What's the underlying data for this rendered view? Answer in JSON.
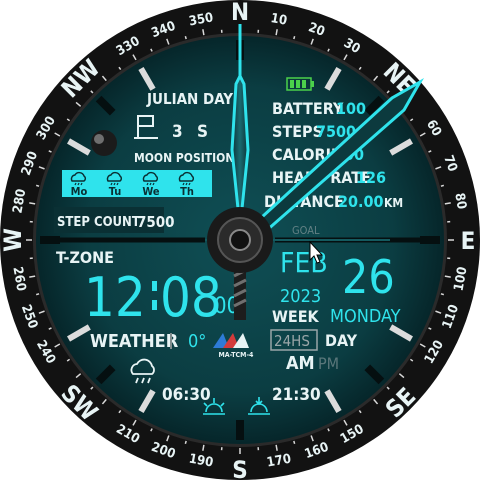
{
  "compass": {
    "cardinals": {
      "n": "N",
      "ne": "NE",
      "e": "E",
      "se": "SE",
      "s": "S",
      "sw": "SW",
      "w": "W",
      "nw": "NW"
    },
    "degrees": [
      "10",
      "20",
      "30",
      "60",
      "70",
      "80",
      "100",
      "110",
      "120",
      "150",
      "160",
      "170",
      "190",
      "200",
      "210",
      "240",
      "250",
      "260",
      "280",
      "290",
      "300",
      "330",
      "340",
      "350"
    ]
  },
  "julian": {
    "label": "JULIAN DAY",
    "value": "3",
    "unit": "S"
  },
  "moon": {
    "label": "MOON POSITION"
  },
  "forecast": {
    "days": [
      "Mo",
      "Tu",
      "We",
      "Th"
    ]
  },
  "steps": {
    "label": "STEP COUNT",
    "value": "7500",
    "goal_label": "GOAL"
  },
  "stats": {
    "battery_label": "BATTERY",
    "battery_value": "100",
    "steps_label": "STEPS",
    "steps_value": "7500",
    "calorie_label": "CALORIE",
    "calorie_value": "500",
    "heart_label": "HEART RATE",
    "heart_value": "126",
    "distance_label": "DISTANCE",
    "distance_value": "20.00",
    "distance_unit": "KM"
  },
  "time": {
    "zone_label": "T-ZONE",
    "hours": "12",
    "minutes": "08",
    "seconds": "00"
  },
  "date": {
    "month": "FEB",
    "day": "26",
    "year": "2023",
    "week_label": "WEEK",
    "weekday": "MONDAY"
  },
  "weather": {
    "label": "WEATHER",
    "temp": "0°"
  },
  "brand": {
    "name": "MA-TCM-4"
  },
  "format": {
    "h24": "24HS",
    "day_label": "DAY",
    "am": "AM",
    "pm": "PM"
  },
  "sun": {
    "sunrise": "06:30",
    "sunset": "21:30"
  },
  "colors": {
    "accent": "#2fe3ec",
    "dial": "#0d4448",
    "bezel": "#141414"
  }
}
